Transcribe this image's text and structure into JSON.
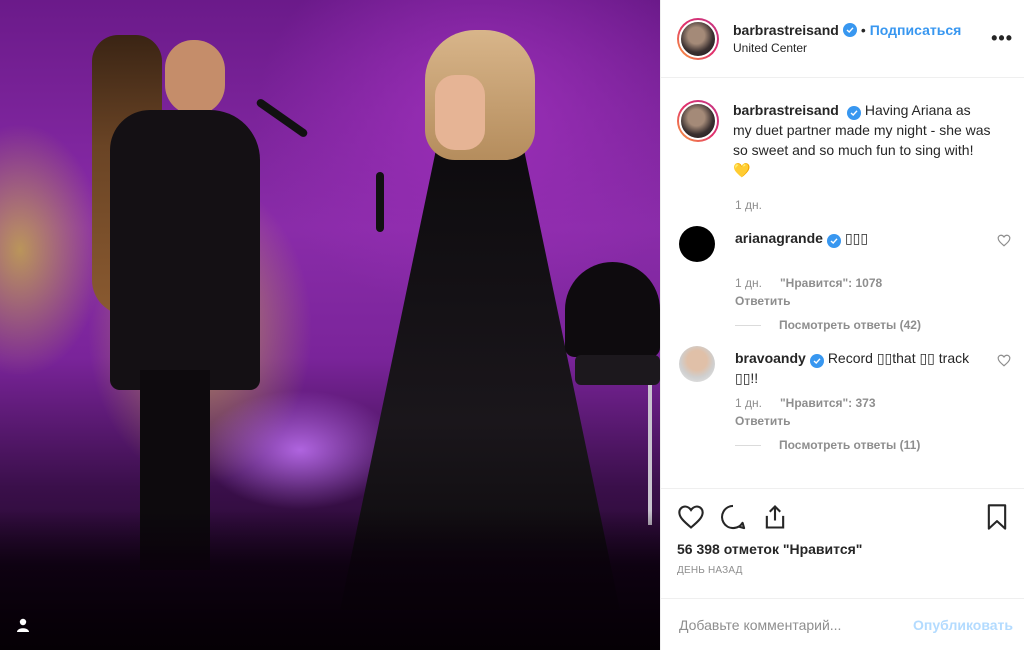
{
  "post": {
    "author": "barbrastreisand",
    "follow_label": "Подписаться",
    "separator": "•",
    "location": "United Center",
    "more_label": "•••",
    "caption": "Having Ariana as my duet partner made my night - she was so sweet and so much fun to sing with!",
    "caption_emoji": "💛",
    "caption_time": "1 дн."
  },
  "comments": [
    {
      "username": "arianagrande",
      "text": "▯▯▯",
      "time": "1 дн.",
      "likes": "\"Нравится\": 1078",
      "reply_label": "Ответить",
      "view_replies": "Посмотреть ответы (42)"
    },
    {
      "username": "bravoandy",
      "text": "Record ▯▯that ▯▯ track ▯▯!!",
      "time": "1 дн.",
      "likes": "\"Нравится\": 373",
      "reply_label": "Ответить",
      "view_replies": "Посмотреть ответы (11)"
    }
  ],
  "actions": {
    "like_icon": "heart-icon",
    "comment_icon": "comment-icon",
    "share_icon": "share-icon",
    "save_icon": "bookmark-icon"
  },
  "likes_count": "56 398 отметок \"Нравится\"",
  "post_date": "ДЕНЬ НАЗАД",
  "comment_box": {
    "placeholder": "Добавьте комментарий...",
    "publish_label": "Опубликовать"
  },
  "colors": {
    "accent": "#3897f0",
    "publish_disabled": "#b3dbff",
    "muted": "#8e8e8e",
    "text": "#262626"
  }
}
